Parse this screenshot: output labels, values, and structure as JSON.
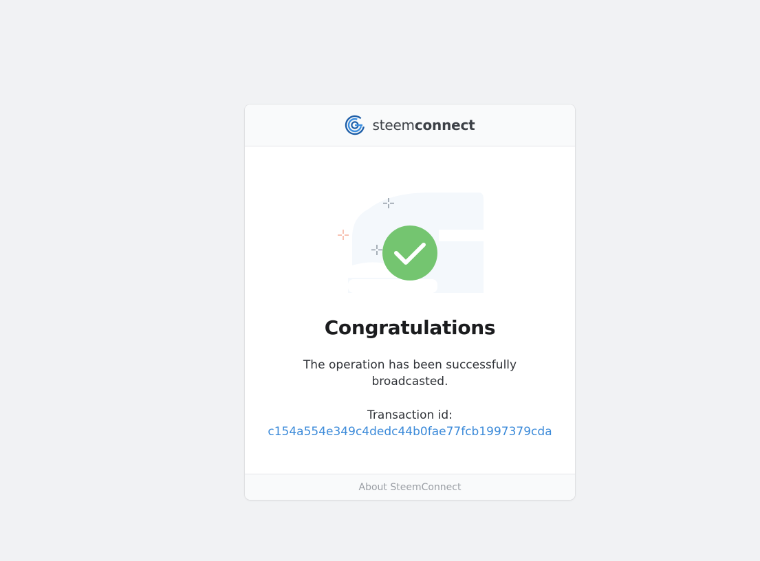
{
  "header": {
    "brand_light": "steem",
    "brand_bold": "connect",
    "logo_icon": "steemconnect-logo-icon"
  },
  "illustration": {
    "icon": "success-check-icon",
    "check_color": "#74c570",
    "background_color": "#f4f8fc"
  },
  "main": {
    "title": "Congratulations",
    "message": "The operation has been successfully broadcasted.",
    "transaction_label": "Transaction id:",
    "transaction_id": "c154a554e349c4dedc44b0fae77fcb1997379cda"
  },
  "footer": {
    "about_label": "About SteemConnect"
  },
  "colors": {
    "page_background": "#f1f2f4",
    "link": "#3b8ad9",
    "logo_blue": "#2f7fd0"
  }
}
